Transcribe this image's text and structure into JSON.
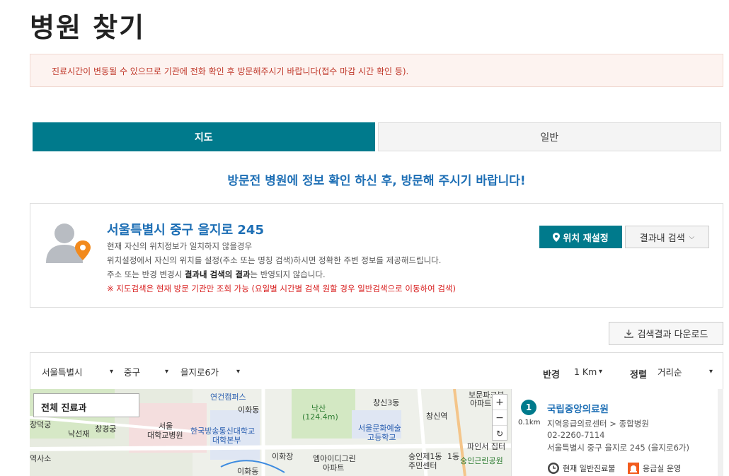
{
  "page_title": "병원 찾기",
  "notice": "진료시간이 변동될 수 있으므로 기관에 전화 확인 후 방문해주시기 바랍니다(접수 마감 시간 확인 등).",
  "tabs": [
    {
      "label": "지도",
      "active": true
    },
    {
      "label": "일반",
      "active": false
    }
  ],
  "guide_text": "방문전 병원에 정보 확인 하신 후, 방문해 주시기 바랍니다!",
  "location": {
    "address": "서울특별시 중구 을지로 245",
    "line1": "현재 자신의 위치정보가 일치하지 않을경우",
    "line2": "위치설정에서 자신의 위치를 설정(주소 또는 명칭 검색)하시면 정확한 주변 정보를 제공해드립니다.",
    "line3_pre": "주소 또는 반경 변경시 ",
    "line3_bold": "결과내 검색의 결과",
    "line3_post": "는 반영되지 않습니다.",
    "warning": "※ 지도검색은 현재 방문 기관만 조회 가능 (요일별 시간별 검색 원할 경우 일반검색으로 이동하여 검색)",
    "reset_button": "위치 재설정",
    "in_search_button": "결과내 검색"
  },
  "download_button": "검색결과 다운로드",
  "filters": {
    "city": "서울특별시",
    "district": "중구",
    "dong": "을지로6가",
    "radius_label": "반경",
    "radius_value": "1 Km",
    "sort_label": "정렬",
    "sort_value": "거리순"
  },
  "map": {
    "category": "전체 진료과",
    "zoom_in": "+",
    "zoom_out": "−",
    "refresh": "↻",
    "labels": [
      "연건캠퍼스",
      "이화동",
      "낙산",
      "(124.4m)",
      "창신3동",
      "창신역",
      "보문파크뷰",
      "아파트",
      "창덕궁",
      "창경궁",
      "낙선재",
      "서울",
      "대학교병원",
      "한국방송통신대학교",
      "대학본부",
      "서울문화예술",
      "고등학교",
      "역사소",
      "이화장",
      "엠아이디그린",
      "아파트",
      "숭인제1동",
      "주민센터",
      "파인서 집터",
      "숭인근린공원",
      "이화동",
      "1동"
    ]
  },
  "results": [
    {
      "rank": "1",
      "distance": "0.1km",
      "name": "국립중앙의료원",
      "category": "지역응급의료센터 > 종합병원",
      "phone": "02-2260-7114",
      "address": "서울특별시 중구 을지로 245 (을지로6가)",
      "tag1": "현재 일반진료불",
      "tag2": "응급실 운영"
    }
  ],
  "colors": {
    "primary": "#007a8c",
    "link": "#1e6fb5",
    "warning": "#d82020"
  }
}
